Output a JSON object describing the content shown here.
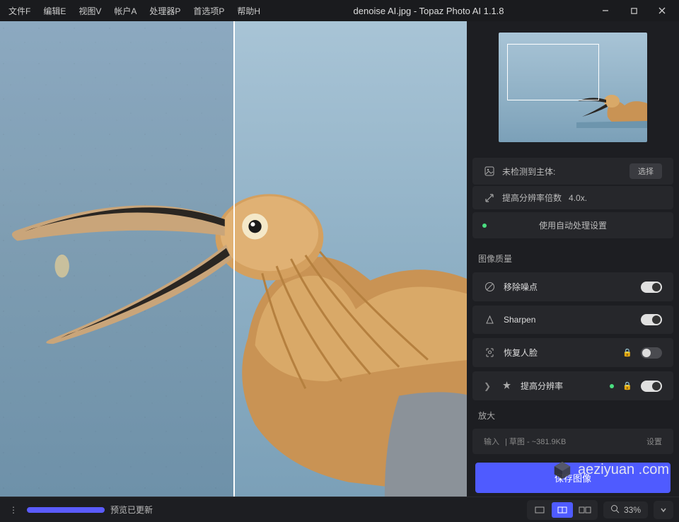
{
  "titlebar": {
    "menu": [
      "文件F",
      "编辑E",
      "视图V",
      "帐户A",
      "处理器P",
      "首选项P",
      "帮助H"
    ],
    "title": "denoise AI.jpg - Topaz Photo AI 1.1.8"
  },
  "sidebar": {
    "subject_row": {
      "label": "未检测到主体:",
      "button": "选择"
    },
    "upscale_row": {
      "label": "提高分辨率倍数",
      "value": "4.0x."
    },
    "auto_row": {
      "label": "使用自动处理设置"
    },
    "quality_title": "图像质量",
    "quality": [
      {
        "icon": "noise",
        "label": "移除噪点",
        "on": true,
        "lock": false,
        "expandable": false
      },
      {
        "icon": "sharpen",
        "label": "Sharpen",
        "on": true,
        "lock": false,
        "expandable": false
      },
      {
        "icon": "face",
        "label": "恢复人脸",
        "on": false,
        "lock": true,
        "expandable": false
      },
      {
        "icon": "enhance",
        "label": "提高分辨率",
        "on": true,
        "lock": true,
        "expandable": true,
        "status_dot": true
      }
    ],
    "scale_title": "放大",
    "scale_info": {
      "prefix": "输入",
      "desc": "| 草图 - ~381.9KB",
      "button": "设置"
    },
    "save_button": "保存图像"
  },
  "watermark": "aeziyuan .com",
  "statusbar": {
    "message": "预览已更新",
    "zoom": "33%"
  }
}
